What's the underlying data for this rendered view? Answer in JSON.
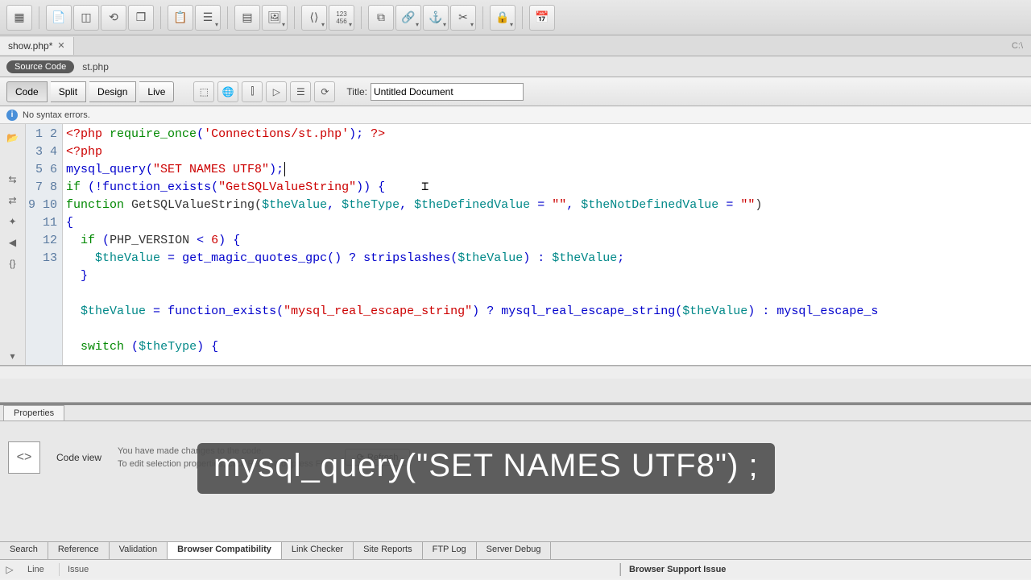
{
  "file_tab": {
    "name": "show.php*",
    "path": "C:\\"
  },
  "related": {
    "pill": "Source Code",
    "link": "st.php"
  },
  "views": {
    "code": "Code",
    "split": "Split",
    "design": "Design",
    "live": "Live"
  },
  "title": {
    "label": "Title:",
    "value": "Untitled Document"
  },
  "status": {
    "msg": "No syntax errors."
  },
  "gutter_start": 1,
  "properties": {
    "tab": "Properties",
    "mode": "Code view",
    "msg1": "You have made changes to the code.",
    "msg2": "To edit selection properties, click Refresh or press F5.",
    "refresh": "Refresh"
  },
  "bottom_tabs": [
    "Search",
    "Reference",
    "Validation",
    "Browser Compatibility",
    "Link Checker",
    "Site Reports",
    "FTP Log",
    "Server Debug"
  ],
  "bottom_active": 3,
  "results": {
    "col1": "Line",
    "col2": "Issue",
    "right": "Browser Support Issue"
  },
  "caption": "mysql_query(\"SET NAMES UTF8\") ;"
}
